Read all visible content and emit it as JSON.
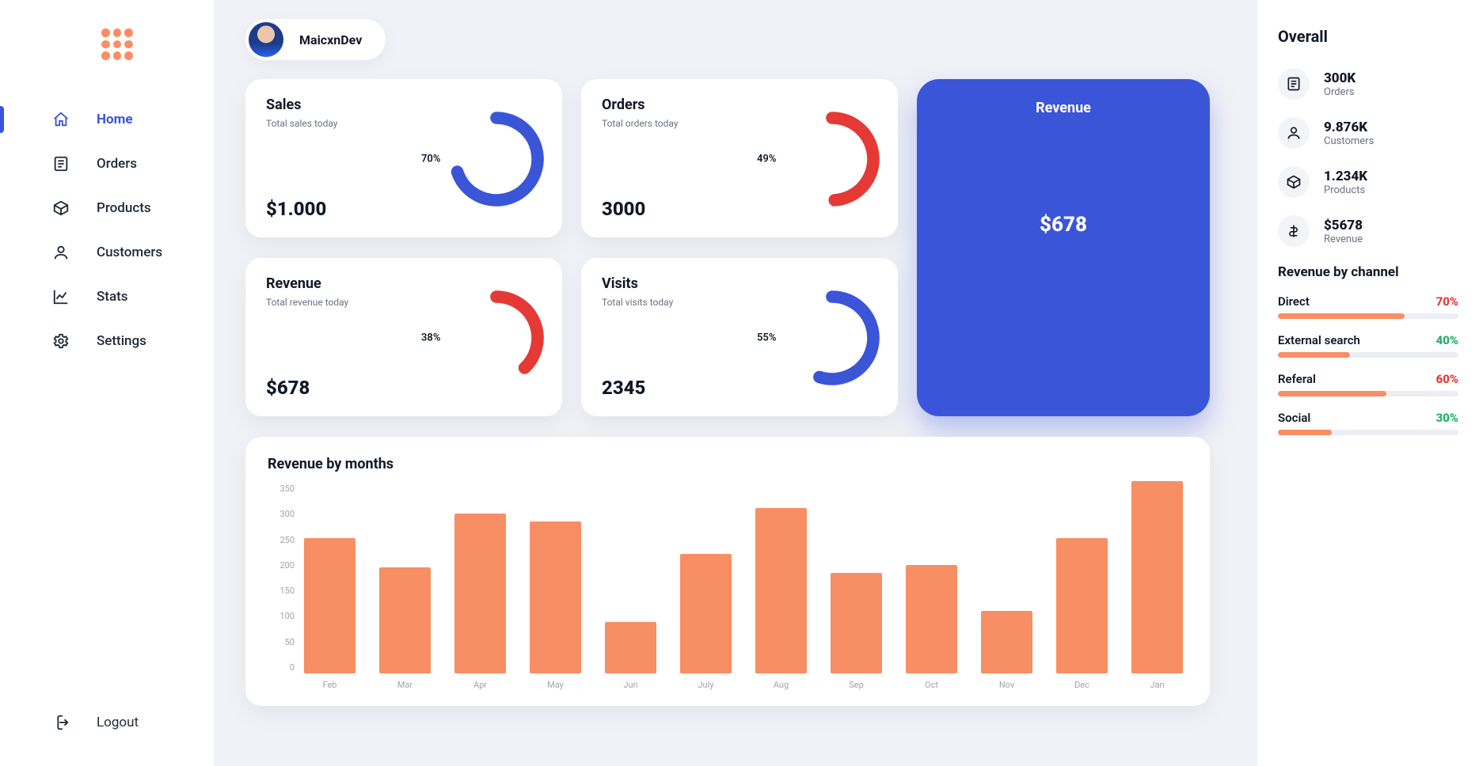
{
  "user": {
    "name": "MaicxnDev"
  },
  "sidebar": {
    "items": [
      {
        "id": "home",
        "label": "Home",
        "active": true
      },
      {
        "id": "orders",
        "label": "Orders",
        "active": false
      },
      {
        "id": "products",
        "label": "Products",
        "active": false
      },
      {
        "id": "customers",
        "label": "Customers",
        "active": false
      },
      {
        "id": "stats",
        "label": "Stats",
        "active": false
      },
      {
        "id": "settings",
        "label": "Settings",
        "active": false
      }
    ],
    "logout": "Logout"
  },
  "cards": {
    "sales": {
      "title": "Sales",
      "subtitle": "Total sales today",
      "value": "$1.000",
      "pct": 70,
      "color": "#3b55d9"
    },
    "orders": {
      "title": "Orders",
      "subtitle": "Total orders today",
      "value": "3000",
      "pct": 49,
      "color": "#e53935"
    },
    "revenue": {
      "title": "Revenue",
      "subtitle": "Total revenue today",
      "value": "$678",
      "pct": 38,
      "color": "#e53935"
    },
    "visits": {
      "title": "Visits",
      "subtitle": "Total visits today",
      "value": "2345",
      "pct": 55,
      "color": "#3b55d9"
    }
  },
  "big_card": {
    "title": "Revenue",
    "amount": "$678"
  },
  "overall": {
    "title": "Overall",
    "items": [
      {
        "value": "300K",
        "label": "Orders"
      },
      {
        "value": "9.876K",
        "label": "Customers"
      },
      {
        "value": "1.234K",
        "label": "Products"
      },
      {
        "value": "$5678",
        "label": "Revenue"
      }
    ]
  },
  "channels": {
    "title": "Revenue by channel",
    "items": [
      {
        "name": "Direct",
        "pct": 70,
        "color": "red"
      },
      {
        "name": "External search",
        "pct": 40,
        "color": "green"
      },
      {
        "name": "Referal",
        "pct": 60,
        "color": "red"
      },
      {
        "name": "Social",
        "pct": 30,
        "color": "green"
      }
    ]
  },
  "chart_title": "Revenue by months",
  "chart_data": {
    "type": "bar",
    "title": "Revenue by months",
    "xlabel": "",
    "ylabel": "",
    "ylim": [
      0,
      350
    ],
    "yticks": [
      0,
      50,
      100,
      150,
      200,
      250,
      300,
      350
    ],
    "categories": [
      "Feb",
      "Mar",
      "Apr",
      "May",
      "Jun",
      "July",
      "Aug",
      "Sep",
      "Oct",
      "Nov",
      "Dec",
      "Jan"
    ],
    "values": [
      250,
      195,
      295,
      280,
      95,
      220,
      305,
      185,
      200,
      115,
      250,
      355
    ],
    "bar_color": "#f88e63"
  }
}
